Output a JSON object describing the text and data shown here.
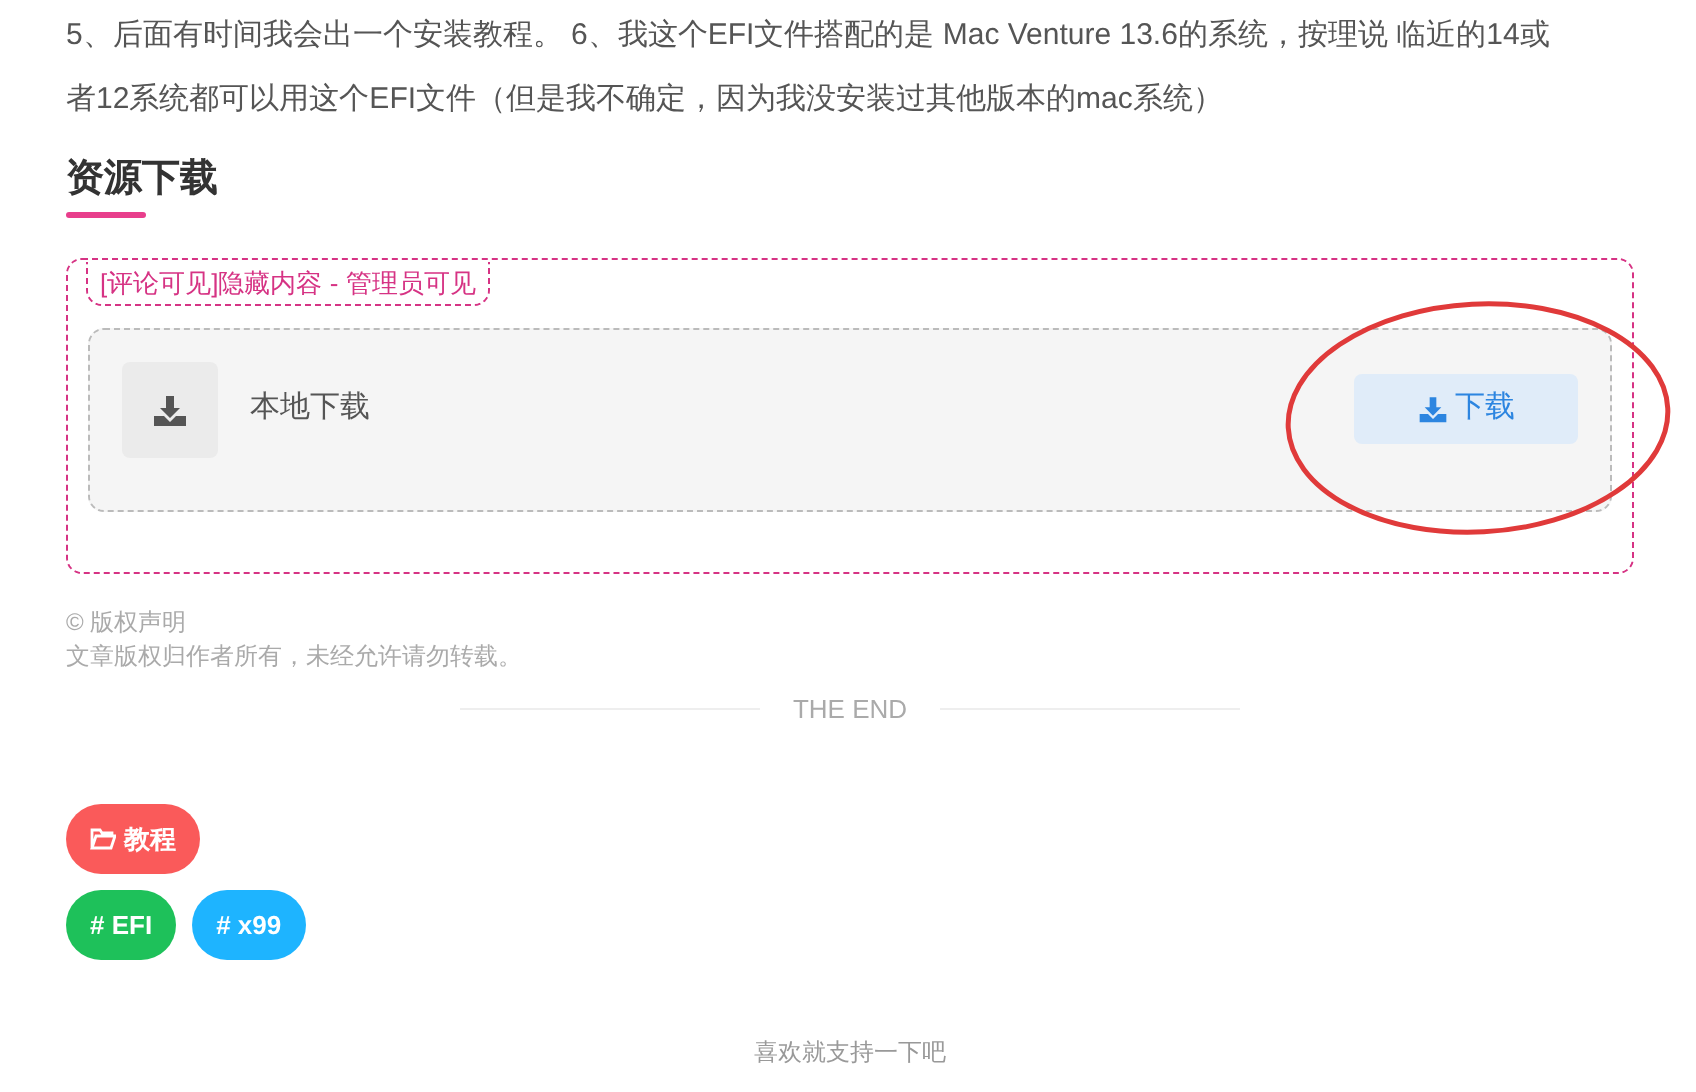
{
  "paragraph": "5、后面有时间我会出一个安装教程。 6、我这个EFI文件搭配的是 Mac Venture 13.6的系统，按理说 临近的14或者12系统都可以用这个EFI文件（但是我不确定，因为我没安装过其他版本的mac系统）",
  "section_title": "资源下载",
  "hidden_box": {
    "label": "[评论可见]隐藏内容 - 管理员可见",
    "item": {
      "title": "本地下载",
      "button": "下载"
    }
  },
  "copyright": {
    "title": "© 版权声明",
    "text": "文章版权归作者所有，未经允许请勿转载。"
  },
  "end_text": "THE END",
  "category": {
    "label": "教程",
    "color": "#fa5a5a"
  },
  "tags": [
    {
      "label": "# EFI",
      "color": "#1ec15a"
    },
    {
      "label": "# x99",
      "color": "#1eb4ff"
    }
  ],
  "footer": "喜欢就支持一下吧"
}
